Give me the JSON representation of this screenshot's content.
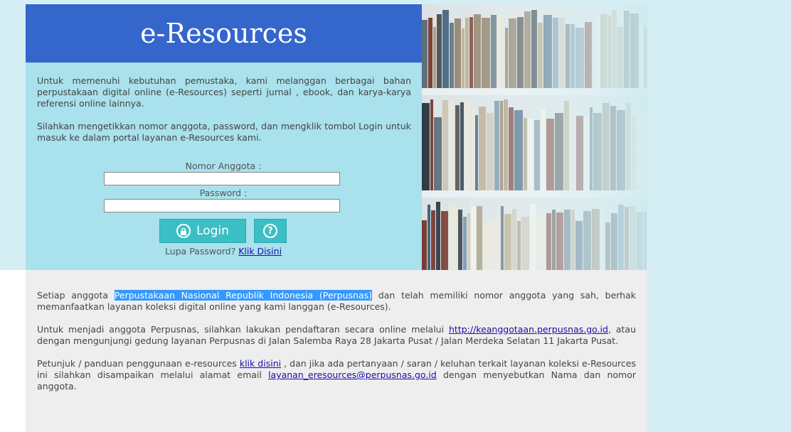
{
  "banner": {
    "title": "e-Resources"
  },
  "intro": {
    "para1": "Untuk memenuhi kebutuhan pemustaka, kami melanggan berbagai bahan perpustakaan digital online (e-Resources) seperti jurnal , ebook, dan karya-karya referensi online lainnya.",
    "para2": "Silahkan mengetikkan nomor anggota, password, dan mengklik tombol Login untuk masuk ke dalam portal layanan e-Resources kami."
  },
  "form": {
    "member_label": "Nomor Anggota :",
    "member_value": "",
    "password_label": "Password :",
    "password_value": "",
    "login_label": "Login",
    "help_glyph": "?",
    "forgot_text": "Lupa Password?",
    "forgot_link": "Klik Disini"
  },
  "info": {
    "p1_before": "Setiap anggota ",
    "p1_highlight": "Perpustakaan Nasional Republik Indonesia (Perpusnas)",
    "p1_after": " dan telah memiliki nomor anggota yang sah, berhak memanfaatkan layanan koleksi digital online yang kami langgan (e-Resources).",
    "p2_before": "Untuk menjadi anggota Perpusnas, silahkan lakukan pendaftaran secara online melalui ",
    "p2_link": "http://keanggotaan.perpusnas.go.id",
    "p2_after": ", atau dengan mengunjungi gedung layanan Perpusnas di Jalan Salemba Raya 28 Jakarta Pusat / Jalan Merdeka Selatan 11 Jakarta Pusat.",
    "p3_before": "Petunjuk / panduan penggunaan e-resources ",
    "p3_link": "klik disini",
    "p3_middle": " , dan jika ada pertanyaan / saran / keluhan terkait layanan koleksi e-Resources ini silahkan disampaikan melalui alamat email ",
    "p3_email": "layanan_eresources@perpusnas.go.id",
    "p3_after": " dengan menyebutkan Nama dan nomor anggota."
  },
  "icons": {
    "lock": "lock-icon",
    "help": "question-icon"
  },
  "colors": {
    "banner": "#3466cc",
    "panel": "#a9e1ed",
    "button": "#3cbfc4",
    "highlight": "#3399ff"
  }
}
